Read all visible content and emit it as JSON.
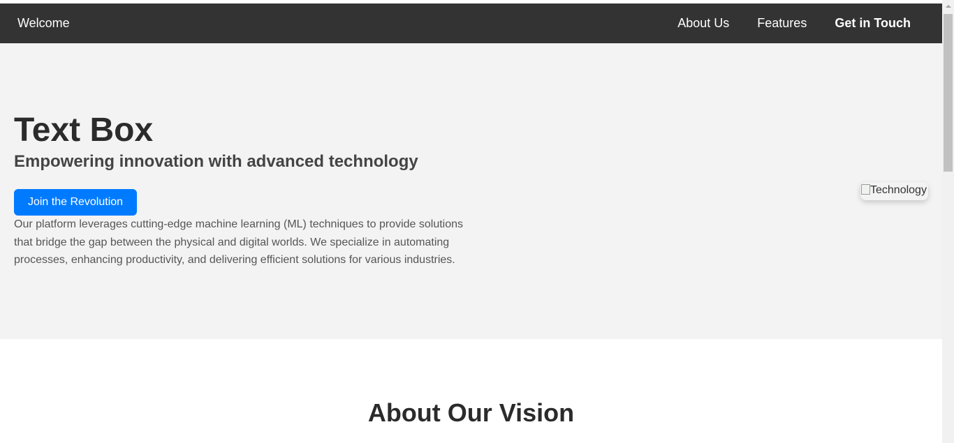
{
  "navbar": {
    "brand": "Welcome",
    "links": [
      {
        "label": "About Us"
      },
      {
        "label": "Features"
      },
      {
        "label": "Get in Touch"
      }
    ]
  },
  "hero": {
    "title": "Text Box",
    "subtitle": "Empowering innovation with advanced technology",
    "cta_label": "Join the Revolution",
    "description": "Our platform leverages cutting-edge machine learning (ML) techniques to provide solutions that bridge the gap between the physical and digital worlds. We specialize in automating processes, enhancing productivity, and delivering efficient solutions for various industries.",
    "image_alt": "Technology"
  },
  "about": {
    "title": "About Our Vision"
  },
  "colors": {
    "navbar_bg": "#333333",
    "hero_bg": "#f3f3f3",
    "accent": "#007bff"
  },
  "icons": {
    "broken_image": "broken-image-icon"
  }
}
